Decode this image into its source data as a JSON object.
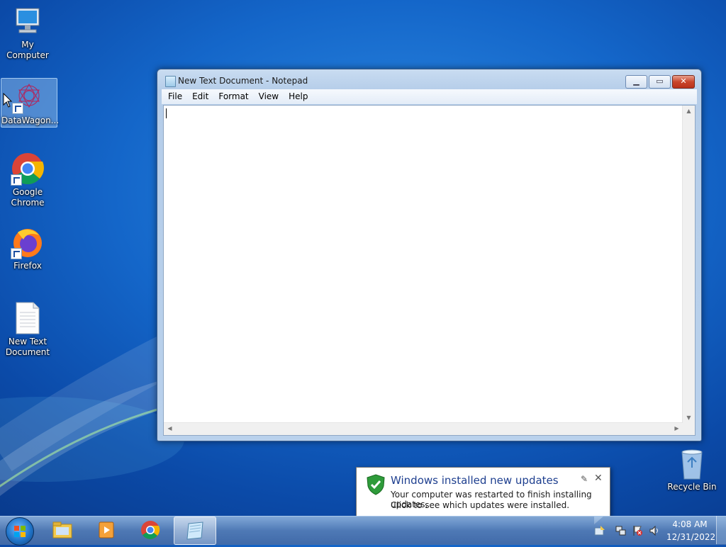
{
  "desktop": {
    "icons": [
      {
        "label": "My Computer",
        "icon": "computer-icon"
      },
      {
        "label": "DataWagon...",
        "icon": "datawagon-icon"
      },
      {
        "label_line1": "Google",
        "label_line2": "Chrome",
        "icon": "chrome-icon"
      },
      {
        "label": "Firefox",
        "icon": "firefox-icon"
      },
      {
        "label_line1": "New Text",
        "label_line2": "Document",
        "icon": "text-document-icon"
      },
      {
        "label": "Recycle Bin",
        "icon": "recycle-bin-icon"
      }
    ]
  },
  "window": {
    "title": "New Text Document - Notepad",
    "menu": [
      "File",
      "Edit",
      "Format",
      "View",
      "Help"
    ],
    "content": ""
  },
  "notification": {
    "title": "Windows installed new updates",
    "line1": "Your computer was restarted to finish installing updates.",
    "line2": "Click to see which updates were installed."
  },
  "taskbar": {
    "items": [
      "start-orb",
      "windows-explorer",
      "media-player",
      "google-chrome",
      "notepad"
    ],
    "clock": {
      "time": "4:08 AM",
      "date": "12/31/2022"
    }
  },
  "colors": {
    "desktop_bg": "#1466c9",
    "balloon_title": "#1e3f8f",
    "close_button": "#c9452b"
  }
}
